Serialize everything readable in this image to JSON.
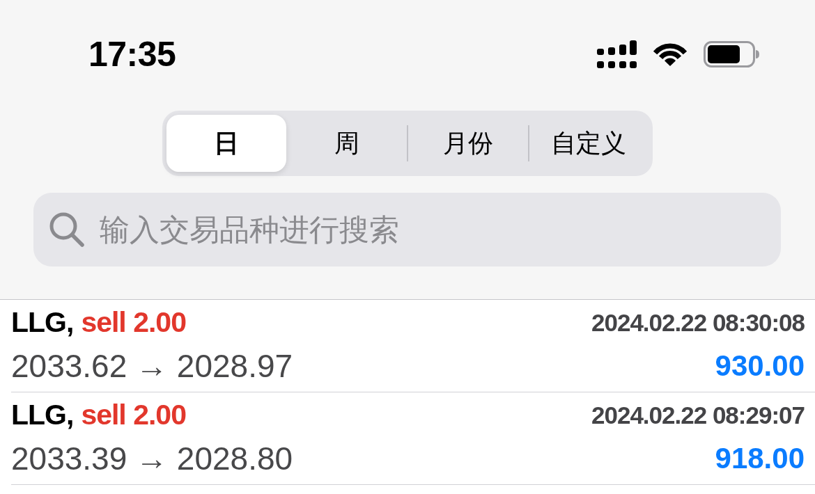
{
  "status_bar": {
    "time": "17:35"
  },
  "segments": [
    {
      "label": "日",
      "selected": true
    },
    {
      "label": "周",
      "selected": false
    },
    {
      "label": "月份",
      "selected": false
    },
    {
      "label": "自定义",
      "selected": false
    }
  ],
  "search": {
    "placeholder": "输入交易品种进行搜索"
  },
  "trades": [
    {
      "symbol": "LLG,",
      "side": "sell",
      "volume": "2.00",
      "time": "2024.02.22 08:30:08",
      "prices": "2033.62 → 2028.97",
      "profit": "930.00"
    },
    {
      "symbol": "LLG,",
      "side": "sell",
      "volume": "2.00",
      "time": "2024.02.22 08:29:07",
      "prices": "2033.39 → 2028.80",
      "profit": "918.00"
    }
  ]
}
